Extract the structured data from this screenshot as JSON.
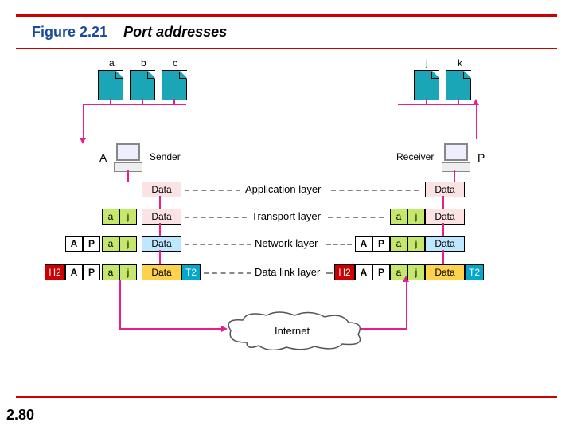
{
  "figure": {
    "number": "Figure 2.21",
    "caption": "Port addresses"
  },
  "page_number": "2.80",
  "processes": {
    "sender": [
      "a",
      "b",
      "c"
    ],
    "receiver": [
      "j",
      "k"
    ]
  },
  "hosts": {
    "sender": {
      "addr": "A",
      "role": "Sender"
    },
    "receiver": {
      "addr": "P",
      "role": "Receiver"
    }
  },
  "layers": {
    "app": {
      "name": "Application layer",
      "pdu": "Data"
    },
    "trans": {
      "name": "Transport layer",
      "hdr": [
        "a",
        "j"
      ],
      "pdu": "Data"
    },
    "net": {
      "name": "Network layer",
      "hdr": [
        "A",
        "P",
        "a",
        "j"
      ],
      "pdu": "Data"
    },
    "dl": {
      "name": "Data link layer",
      "hdr": [
        "H2",
        "A",
        "P",
        "a",
        "j"
      ],
      "pdu": "Data",
      "trailer": "T2"
    }
  },
  "network": "Internet"
}
